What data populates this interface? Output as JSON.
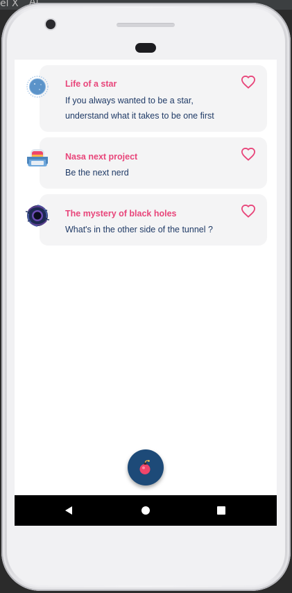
{
  "ide": {
    "tab_left": "el X",
    "tab_right": "Al..."
  },
  "cards": [
    {
      "title": "Life of a star",
      "description": "If you always wanted to be a star, understand what it takes to be one first",
      "icon": "star-planet-icon",
      "favorited": false
    },
    {
      "title": "Nasa next project",
      "description": "Be the next nerd",
      "icon": "astronaut-helmet-icon",
      "favorited": false
    },
    {
      "title": "The mystery of black holes",
      "description": "What's in the other side of the tunnel ?",
      "icon": "black-hole-icon",
      "favorited": false
    }
  ],
  "fab": {
    "icon": "bomb-icon"
  },
  "navbar": {
    "back_icon": "back-triangle-icon",
    "home_icon": "home-circle-icon",
    "recents_icon": "recents-square-icon"
  },
  "colors": {
    "title": "#e8457a",
    "description": "#1f3a66",
    "card_bg": "#f4f4f5",
    "heart": "#e8457a",
    "fab_bg": "#1d4a78",
    "fab_icon": "#f0456a"
  }
}
